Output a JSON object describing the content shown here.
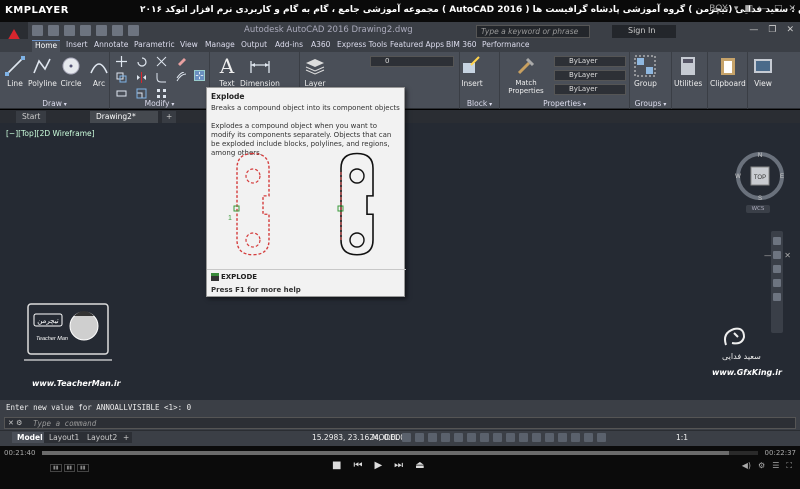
{
  "player": {
    "logo": "KMPLAYER",
    "title": "مجموعه آموزشی جامع ، گام به گام و کاربردی نرم افزار  اتوکد ۲۰۱۶ ( AutoCAD  2016 )  مدرس : سعید فدایی (تیچرمن ) گروه آموزشی پادشاه گرافیست ها",
    "box_label": "BOX",
    "time_elapsed": "00:21:40",
    "time_total": "00:22:37",
    "progress": 0.96
  },
  "app": {
    "doc_title": "Autodesk AutoCAD 2016   Drawing2.dwg",
    "search_placeholder": "Type a keyword or phrase",
    "signin_label": "Sign In"
  },
  "ribbon": {
    "tabs": [
      "Home",
      "Insert",
      "Annotate",
      "Parametric",
      "View",
      "Manage",
      "Output",
      "Add-ins",
      "A360",
      "Express Tools",
      "Featured Apps",
      "BIM 360",
      "Performance"
    ],
    "active_tab": "Home",
    "draw": {
      "title": "Draw",
      "line": "Line",
      "polyline": "Polyline",
      "circle": "Circle",
      "arc": "Arc"
    },
    "modify": {
      "title": "Modify"
    },
    "annotation": {
      "text": "Text",
      "dimension": "Dimension"
    },
    "layers": {
      "layer": "Layer",
      "combo_value": "0"
    },
    "block": {
      "title": "Block",
      "insert": "Insert"
    },
    "properties": {
      "title": "Properties",
      "match": "Match Properties",
      "color": "ByLayer",
      "linetype": "ByLayer",
      "lineweight": "ByLayer"
    },
    "groups": {
      "title": "Groups",
      "group": "Group"
    },
    "utilities": "Utilities",
    "clipboard": "Clipboard",
    "view": "View"
  },
  "doc_tabs": [
    "Start",
    "Drawing2*"
  ],
  "viewport": {
    "label": "[−][Top][2D Wireframe]",
    "viewcube": {
      "top": "TOP",
      "n": "N",
      "s": "S",
      "e": "E",
      "w": "W"
    },
    "wcs": "WCS"
  },
  "tooltip": {
    "title": "Explode",
    "short": "Breaks a compound object into its component objects",
    "long": "Explodes a compound object when you want to modify its components separately. Objects that can be exploded include blocks, polylines, and regions, among others.",
    "illus_label": "1",
    "command": "EXPLODE",
    "help": "Press F1 for more help"
  },
  "watermark": {
    "teacher_brand": "تیچرمن",
    "teacher_sub": "Teacher Man",
    "teacher_url": "www.TeacherMan.ir",
    "gfx_name": "سعید فدایی",
    "gfx_url": "www.GfxKing.ir"
  },
  "command_line": {
    "history": "Enter new value for ANNOALLVISIBLE <1>: 0",
    "placeholder": "Type a command"
  },
  "status": {
    "layout_tabs": [
      "Model",
      "Layout1",
      "Layout2"
    ],
    "active_layout": "Model",
    "coords": "15.2983, 23.1624, 0.0000",
    "model": "MODEL",
    "scale": "1:1"
  },
  "colors": {
    "accent": "#d7262e",
    "tooltip_red": "#d43c3c",
    "canvas": "#252a33"
  }
}
